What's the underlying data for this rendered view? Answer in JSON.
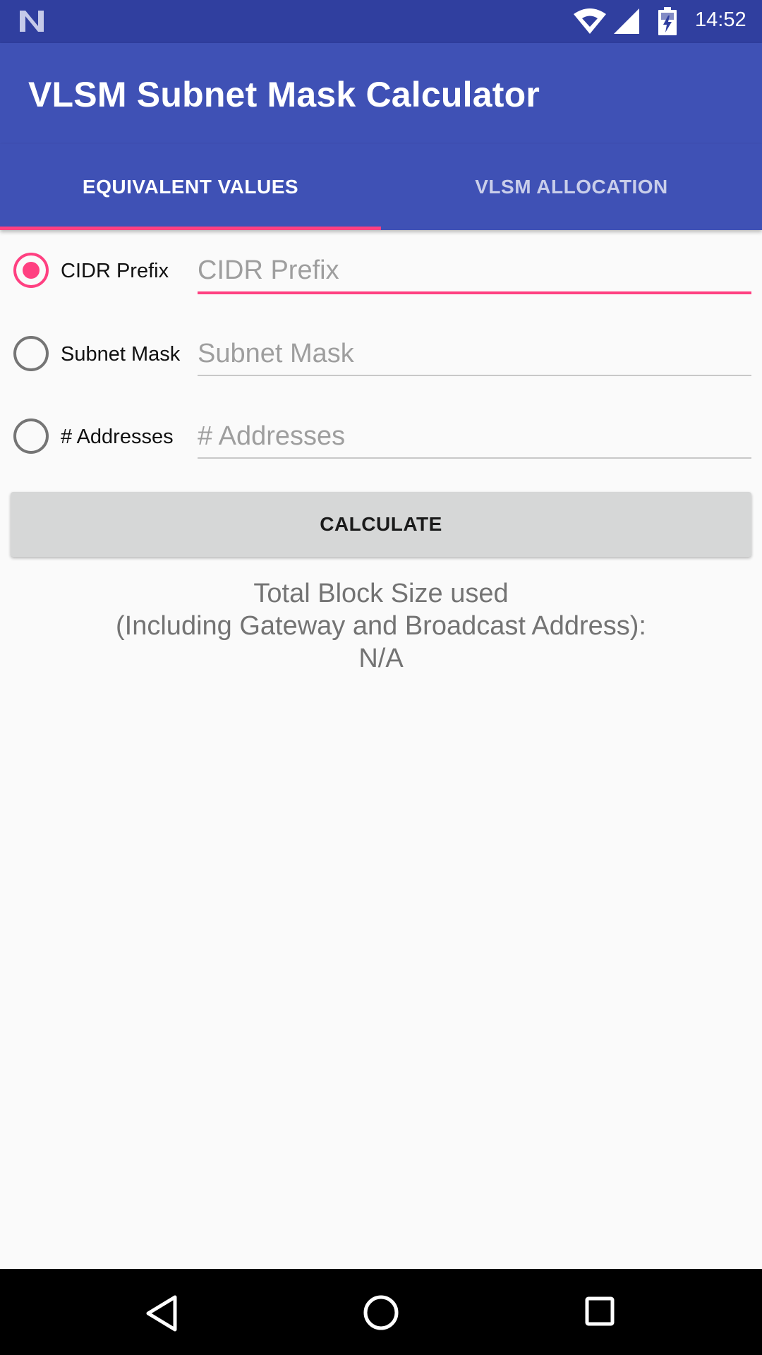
{
  "status_bar": {
    "time": "14:52",
    "icons": [
      "notification-n-icon",
      "wifi-icon",
      "cell-signal-icon",
      "battery-charging-icon"
    ]
  },
  "app_bar": {
    "title": "VLSM Subnet Mask Calculator"
  },
  "tabs": [
    {
      "label": "EQUIVALENT VALUES",
      "selected": true
    },
    {
      "label": "VLSM ALLOCATION",
      "selected": false
    }
  ],
  "fields": [
    {
      "radio_label": "CIDR Prefix",
      "placeholder": "CIDR Prefix",
      "value": "",
      "checked": true
    },
    {
      "radio_label": "Subnet Mask",
      "placeholder": "Subnet Mask",
      "value": "",
      "checked": false
    },
    {
      "radio_label": "# Addresses",
      "placeholder": "# Addresses",
      "value": "",
      "checked": false
    }
  ],
  "calculate_label": "CALCULATE",
  "result": {
    "line1": "Total Block Size used",
    "line2": "(Including Gateway and Broadcast Address):",
    "value": "N/A"
  },
  "nav_bar": {
    "icons": [
      "back-icon",
      "home-icon",
      "recent-apps-icon"
    ]
  },
  "colors": {
    "primary": "#3f51b5",
    "primary_dark": "#303f9f",
    "accent": "#ff4081",
    "background": "#fafafa"
  }
}
